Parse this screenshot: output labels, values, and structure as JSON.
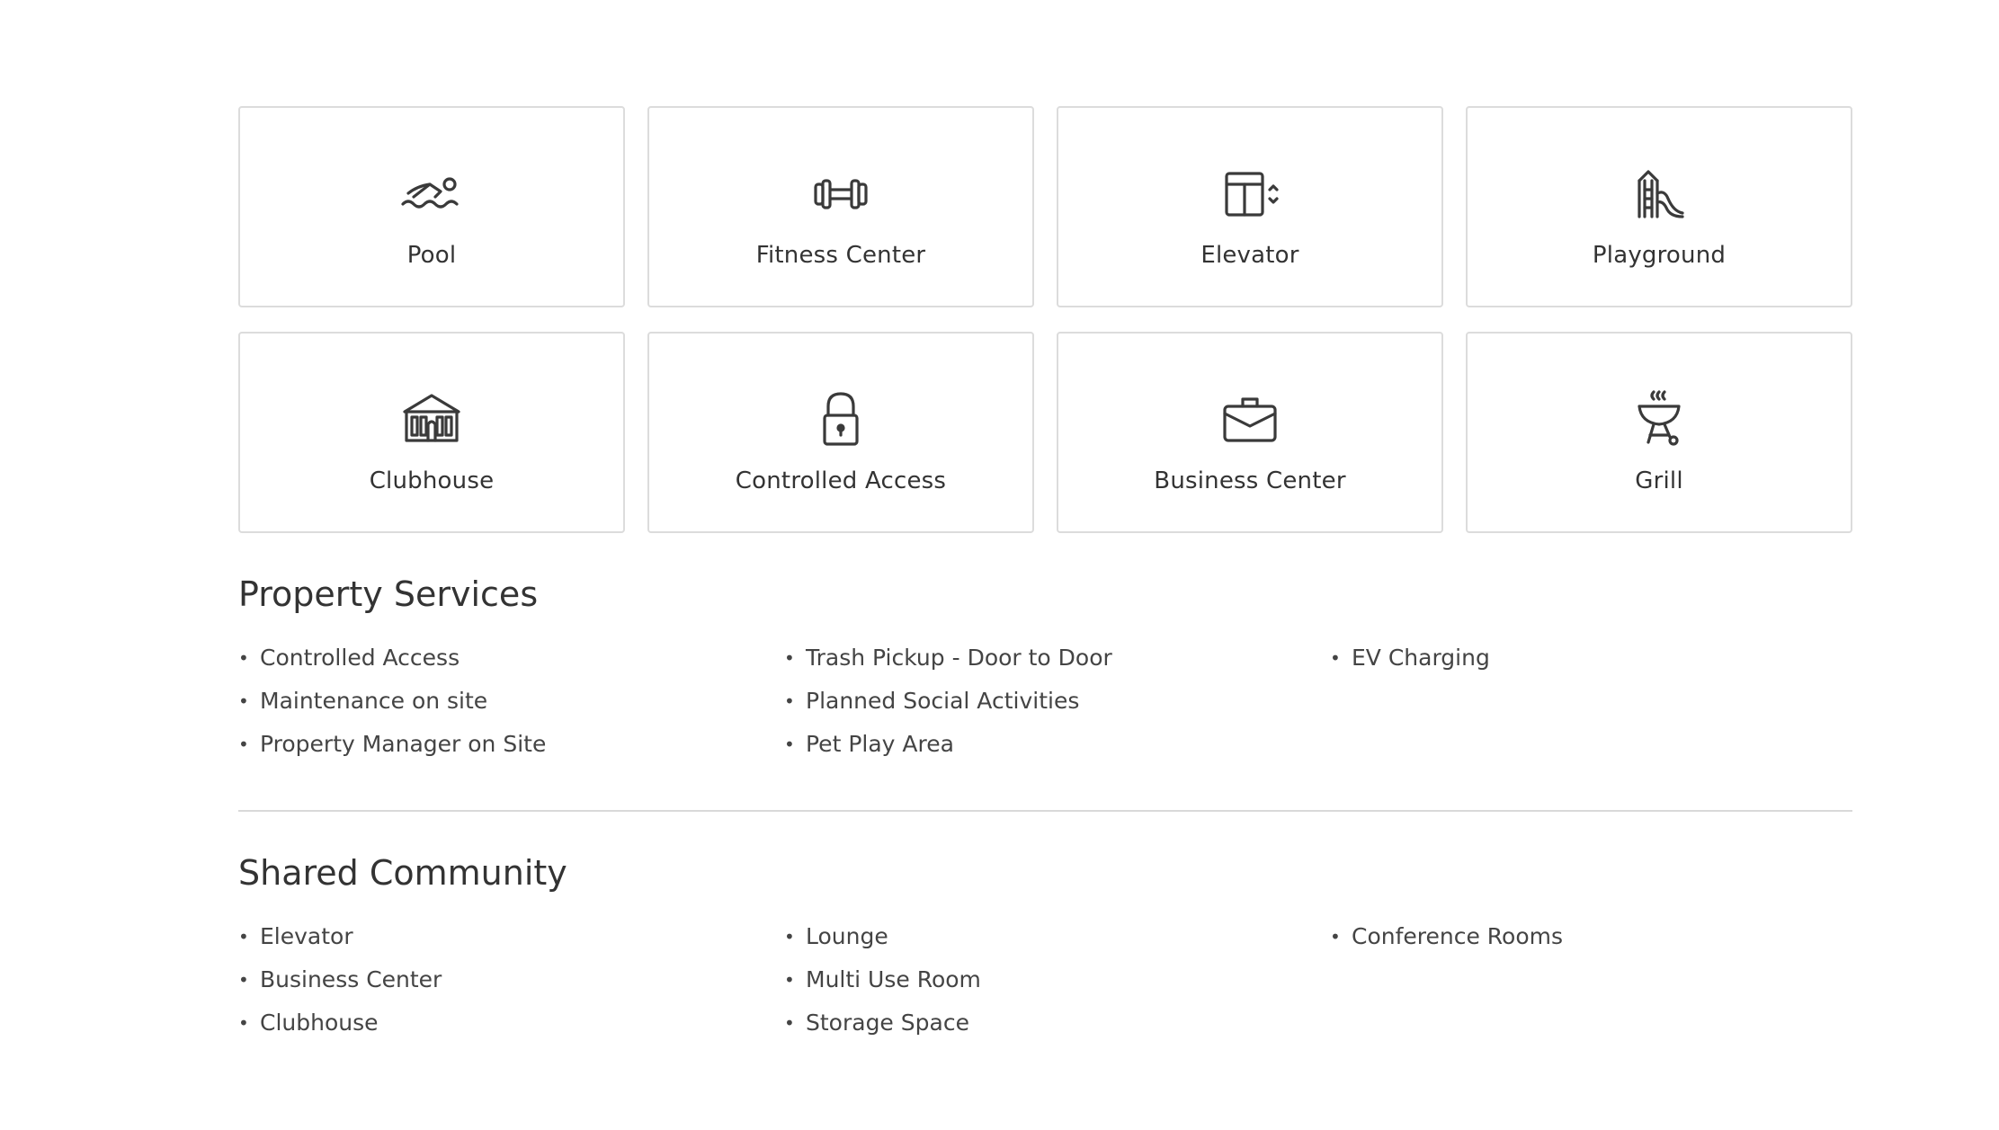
{
  "amenities": [
    {
      "label": "Pool",
      "icon": "swimmer-icon"
    },
    {
      "label": "Fitness Center",
      "icon": "dumbbell-icon"
    },
    {
      "label": "Elevator",
      "icon": "elevator-icon"
    },
    {
      "label": "Playground",
      "icon": "playground-slide-icon"
    },
    {
      "label": "Clubhouse",
      "icon": "clubhouse-building-icon"
    },
    {
      "label": "Controlled Access",
      "icon": "padlock-icon"
    },
    {
      "label": "Business Center",
      "icon": "briefcase-icon"
    },
    {
      "label": "Grill",
      "icon": "bbq-grill-icon"
    }
  ],
  "property_services": {
    "title": "Property Services",
    "columns": [
      [
        "Controlled Access",
        "Maintenance on site",
        "Property Manager on Site"
      ],
      [
        "Trash Pickup - Door to Door",
        "Planned Social Activities",
        "Pet Play Area"
      ],
      [
        "EV Charging"
      ]
    ]
  },
  "shared_community": {
    "title": "Shared Community",
    "columns": [
      [
        "Elevator",
        "Business Center",
        "Clubhouse"
      ],
      [
        "Lounge",
        "Multi Use Room",
        "Storage Space"
      ],
      [
        "Conference Rooms"
      ]
    ]
  },
  "colors": {
    "text": "#333333",
    "border": "#dcdcdc",
    "background": "#ffffff"
  }
}
